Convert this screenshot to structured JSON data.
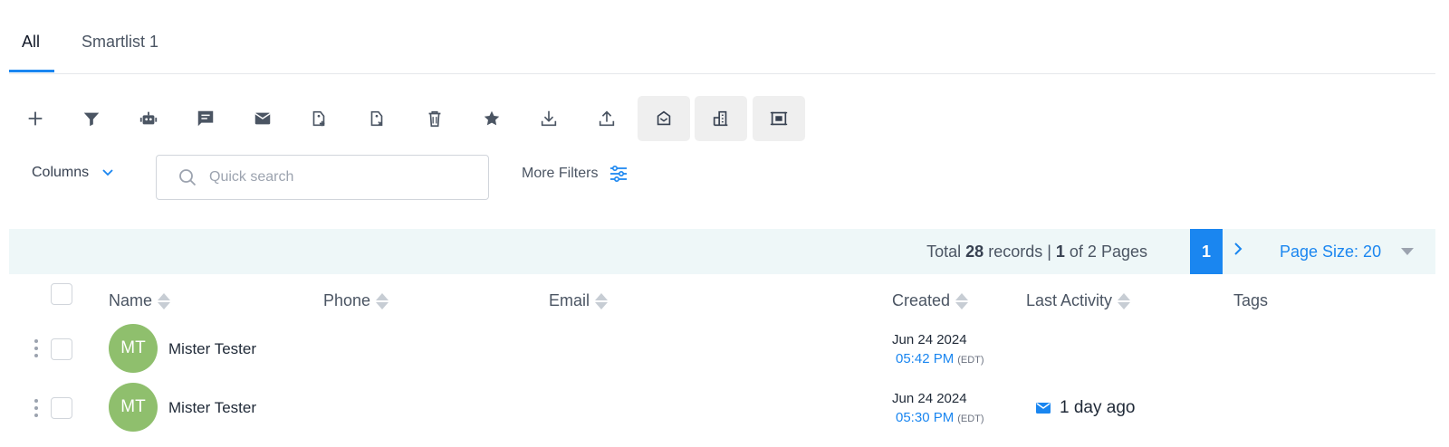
{
  "tabs": [
    {
      "label": "All",
      "active": true
    },
    {
      "label": "Smartlist 1",
      "active": false
    }
  ],
  "toolbar": {
    "icons": [
      "add-icon",
      "filter-icon",
      "robot-icon",
      "message-icon",
      "email-icon",
      "add-tag-icon",
      "remove-tag-icon",
      "delete-icon",
      "star-icon",
      "download-icon",
      "upload-icon",
      "mailbox-icon",
      "company-icon",
      "merge-icon"
    ]
  },
  "controls": {
    "columns_label": "Columns",
    "search_placeholder": "Quick search",
    "more_filters_label": "More Filters"
  },
  "pagination": {
    "total_prefix": "Total ",
    "total_count": "28",
    "total_records": " records | ",
    "current_page": "1",
    "of_pages": " of 2 Pages",
    "page_button": "1",
    "page_size_label": "Page Size: 20"
  },
  "table": {
    "headers": {
      "name": "Name",
      "phone": "Phone",
      "email": "Email",
      "created": "Created",
      "last_activity": "Last Activity",
      "tags": "Tags"
    },
    "rows": [
      {
        "initials": "MT",
        "name": "Mister Tester",
        "created_date": "Jun 24 2024",
        "created_time": "05:42 PM",
        "tz": "(EDT)",
        "last_activity": ""
      },
      {
        "initials": "MT",
        "name": "Mister Tester",
        "created_date": "Jun 24 2024",
        "created_time": "05:30 PM",
        "tz": "(EDT)",
        "last_activity": "1 day ago"
      }
    ]
  },
  "colors": {
    "accent": "#1a86f0",
    "avatar": "#8fbf6d",
    "pagebar_bg": "#eef7f8"
  }
}
